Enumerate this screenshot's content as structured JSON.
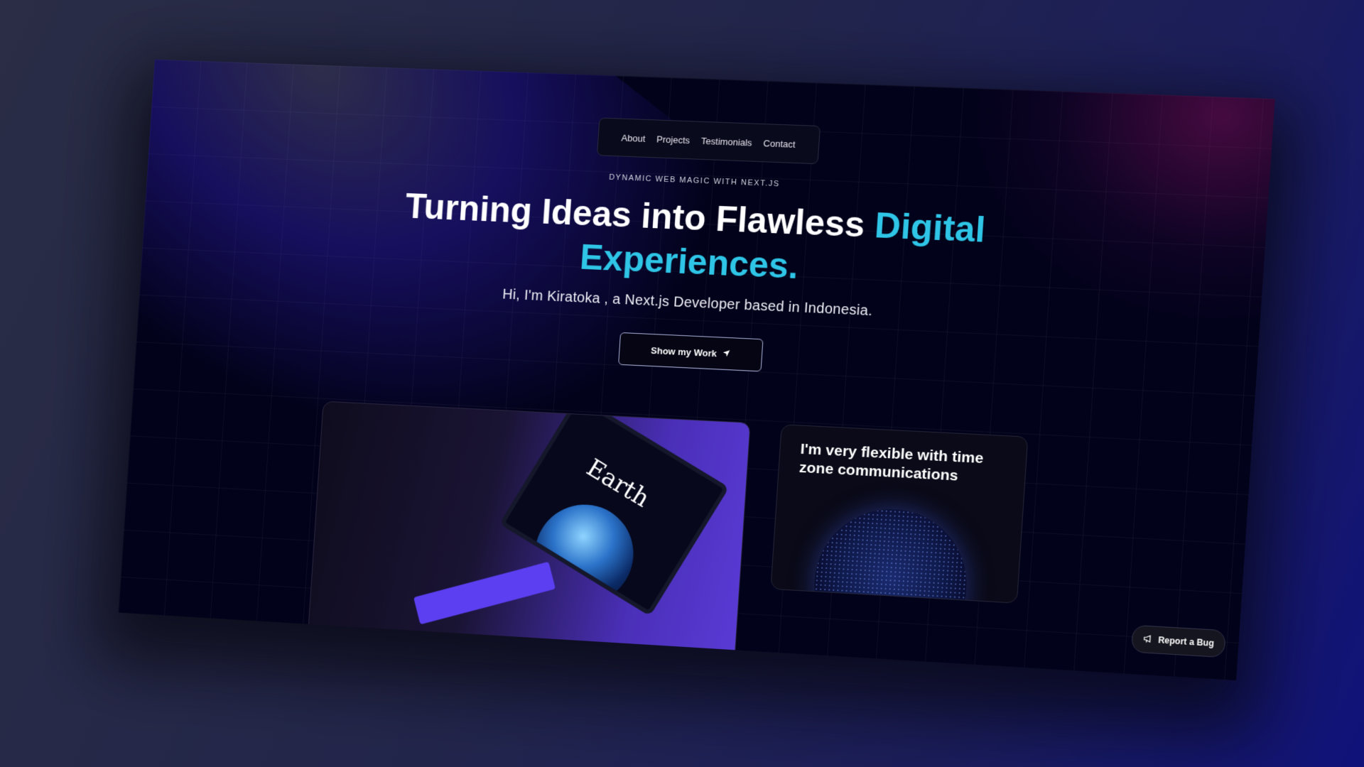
{
  "nav": {
    "items": [
      {
        "label": "About"
      },
      {
        "label": "Projects"
      },
      {
        "label": "Testimonials"
      },
      {
        "label": "Contact"
      }
    ]
  },
  "hero": {
    "eyebrow": "Dynamic Web Magic with Next.js",
    "headline_part1": "Turning Ideas into Flawless ",
    "headline_accent": "Digital Experiences.",
    "subtitle": "Hi, I'm Kiratoka , a Next.js Developer based in Indonesia.",
    "cta_label": "Show my Work"
  },
  "cards": {
    "project_preview": {
      "laptop_title": "Earth"
    },
    "timezone": {
      "title": "I'm very flexible with time zone communications"
    }
  },
  "report_bug": {
    "label": "Report a Bug"
  },
  "colors": {
    "accent": "#2ec5e6",
    "background": "#02021a"
  }
}
